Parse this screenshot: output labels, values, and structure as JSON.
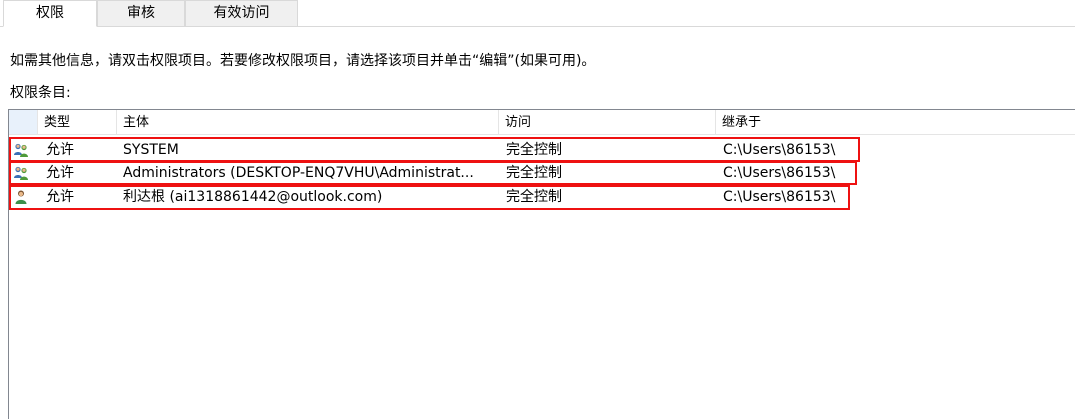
{
  "tabs": [
    {
      "label": "权限"
    },
    {
      "label": "审核"
    },
    {
      "label": "有效访问"
    }
  ],
  "info_text": "如需其他信息，请双击权限项目。若要修改权限项目，请选择该项目并单击“编辑”(如果可用)。",
  "entries_label": "权限条目:",
  "columns": {
    "type": "类型",
    "principal": "主体",
    "access": "访问",
    "inherited_from": "继承于"
  },
  "rows": [
    {
      "icon": "group-users-icon",
      "type": "允许",
      "principal": "SYSTEM",
      "access": "完全控制",
      "inherited_from": "C:\\Users\\86153\\"
    },
    {
      "icon": "group-users-icon",
      "type": "允许",
      "principal": "Administrators (DESKTOP-ENQ7VHU\\Administrat...",
      "access": "完全控制",
      "inherited_from": "C:\\Users\\86153\\"
    },
    {
      "icon": "single-user-icon",
      "type": "允许",
      "principal": "利达根 (ai1318861442@outlook.com)",
      "access": "完全控制",
      "inherited_from": "C:\\Users\\86153\\"
    }
  ],
  "colors": {
    "highlight": "#ee1111",
    "header_first_cell": "#e8f1fb"
  }
}
